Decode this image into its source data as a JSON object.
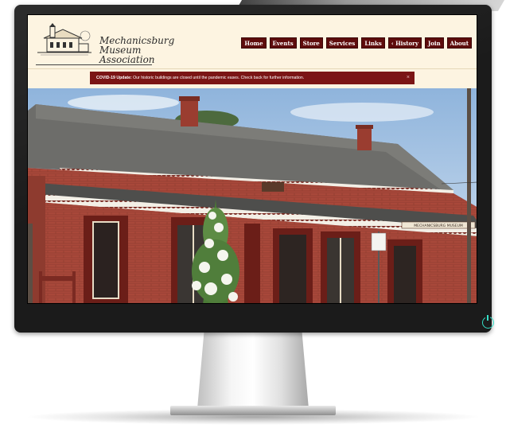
{
  "site": {
    "logo": {
      "line1": "Mechanicsburg",
      "line2": "Museum",
      "line3": "Association"
    },
    "nav": [
      {
        "label": "Home"
      },
      {
        "label": "Events"
      },
      {
        "label": "Store"
      },
      {
        "label": "Services"
      },
      {
        "label": "Links"
      },
      {
        "label": "‹ History"
      },
      {
        "label": "Join"
      },
      {
        "label": "About"
      }
    ],
    "alert": {
      "title": "COVID-19 Update:",
      "message": " Our historic buildings are closed until the pandemic eases. Check back for further information.",
      "close": "×"
    },
    "hero": {
      "sign_text": "MECHANICSBURG MUSEUM"
    }
  },
  "colors": {
    "nav_bg": "#5e0c0c",
    "alert_bg": "#7b1515",
    "header_bg": "#fdf4e1",
    "bezel": "#1b1b1b",
    "power_led": "#35e0c8"
  },
  "icons": {
    "power": "power-icon"
  }
}
